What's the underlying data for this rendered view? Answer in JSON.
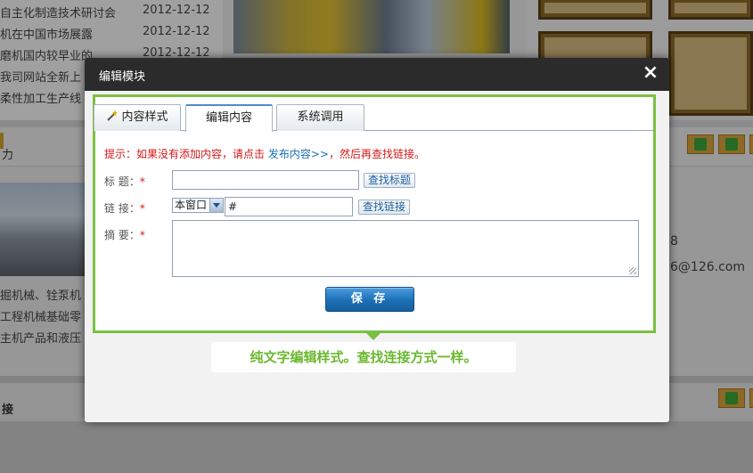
{
  "background": {
    "news": [
      {
        "title": "自主化制造技术研讨会",
        "date": "2012-12-12"
      },
      {
        "title": "机在中国市场展露",
        "date": "2012-12-12"
      },
      {
        "title": "磨机国内较早业的",
        "date": "2012-12-12"
      },
      {
        "title": "我司网站全新上",
        "date": ""
      },
      {
        "title": "柔性加工生产线",
        "date": ""
      }
    ],
    "section_label_1": "力",
    "product_lines": [
      "掘机械、铨泵机",
      "工程机械基础零",
      "主机产品和液压"
    ],
    "contact_phone_tail": "8",
    "contact_email_tail": "6@126.com",
    "section_label_2": "接"
  },
  "modal": {
    "title": "编辑模块",
    "close_glyph": "×",
    "tabs": [
      {
        "label": "内容样式"
      },
      {
        "label": "编辑内容"
      },
      {
        "label": "系统调用"
      }
    ],
    "active_tab": "编辑内容",
    "hint_prefix": "提示：如果没有添加内容，请点击",
    "hint_link": "发布内容>>",
    "hint_suffix": "，然后再查找链接。",
    "title_label": "标 题：",
    "title_value": "",
    "find_title_button": "查找标题",
    "link_label": "链 接：",
    "target_option": "本窗口",
    "link_value": "#",
    "find_link_button": "查找链接",
    "summary_label": "摘 要：",
    "summary_value": "",
    "required_mark": "*",
    "save_button": "保 存"
  },
  "callout": {
    "text": "纯文字编辑样式。查找连接方式一样。"
  },
  "colors": {
    "accent_green": "#7ac143",
    "header_dark": "#2b2b2b",
    "save_blue": "#1d6fb5",
    "hint_red": "#d41919",
    "link_blue": "#1b6fb5"
  },
  "icons": {
    "wand": "magic-wand-icon",
    "close": "close-icon",
    "select_arrow": "chevron-down-icon"
  }
}
